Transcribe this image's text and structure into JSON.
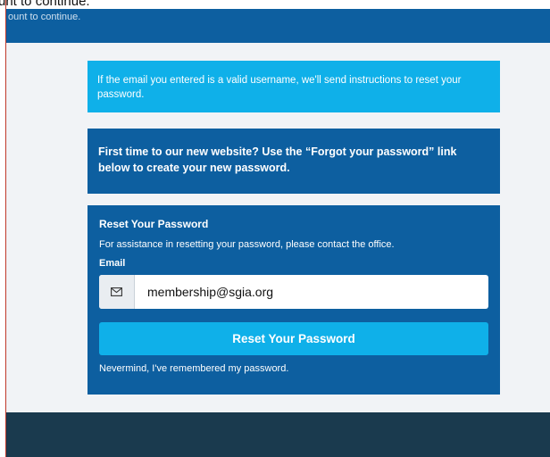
{
  "top_text": "unt to continue.",
  "header": {
    "subtext": "ount to continue."
  },
  "alerts": {
    "info_text": "If the email you entered is a valid username, we'll send instructions to reset your password.",
    "first_time_text": "First time to our new website? Use the “Forgot your password” link below to create your new password."
  },
  "reset": {
    "title": "Reset Your Password",
    "description": "For assistance in resetting your password, please contact the office.",
    "email_label": "Email",
    "email_value": "membership@sgia.org",
    "email_icon": "envelope-icon",
    "button_label": "Reset Your Password",
    "nevermind_label": "Nevermind, I've remembered my password."
  },
  "colors": {
    "header_blue": "#0d5fa0",
    "info_cyan": "#0fb0e9",
    "footer_dark": "#1a3a4e",
    "content_bg": "#f1f3f6"
  }
}
